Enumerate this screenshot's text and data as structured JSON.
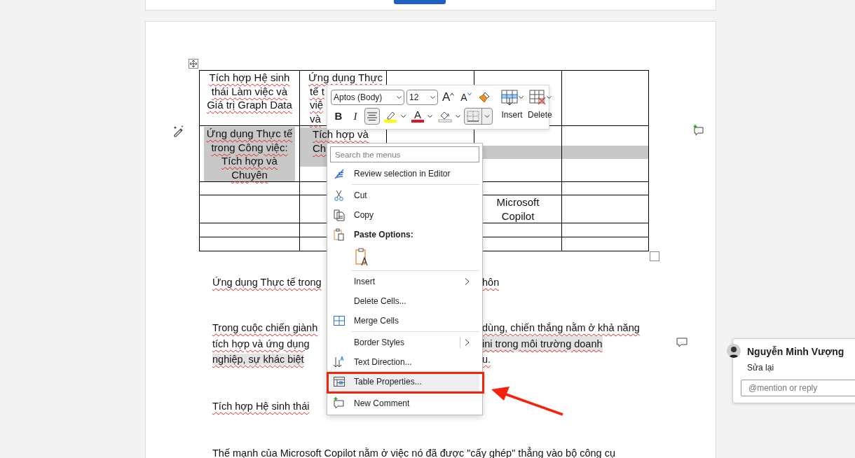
{
  "table": {
    "rows": [
      [
        {
          "lines": [
            "Tích hợp Hệ sinh",
            "thái Làm việc và",
            "Giá trị Graph Data"
          ]
        },
        {
          "lines": [
            "Ứng dụng Thực",
            "tế t",
            "việ",
            "và"
          ],
          "partial": true
        },
        {},
        {},
        {}
      ],
      [
        {
          "lines": [
            "Ứng dụng Thực tế",
            "trong Công việc:",
            "Tích hợp và",
            "Chuyên"
          ],
          "shaded": true
        },
        {
          "lines": [
            "Tích hợp và",
            "Ch"
          ],
          "shaded": true,
          "partial": true
        },
        {},
        {
          "shaded": true
        },
        {
          "shaded": true
        }
      ],
      [
        {},
        {},
        {},
        {},
        {}
      ],
      [
        {},
        {},
        {},
        {
          "lines": [
            "Microsoft",
            "Copilot"
          ]
        },
        {}
      ],
      [
        {},
        {},
        {},
        {},
        {}
      ],
      [
        {},
        {},
        {},
        {},
        {}
      ]
    ]
  },
  "paragraphs": [
    {
      "lines": [
        {
          "left": {
            "text": "Ứng dụng Thực tế trong"
          },
          "right": {
            "text": "hôn"
          }
        }
      ]
    },
    {
      "lines": [
        {
          "left": {
            "text": "Trong cuộc chiến giành"
          },
          "right": {
            "text": "dùng, chiến thắng nằm ở khả năng"
          }
        },
        {
          "left": {
            "text": "tích hợp và ứng dụng"
          },
          "right": {
            "text": "ini trong môi trường doanh",
            "highlighted": true
          }
        },
        {
          "left": {
            "text": "nghiệp, sự khác biệt",
            "highlighted": true
          },
          "right": {
            "text": "u."
          }
        }
      ]
    },
    {
      "lines": [
        {
          "left": {
            "text": "Tích hợp Hệ sinh thái"
          }
        }
      ]
    },
    {
      "lines": [
        {
          "left": {
            "text": "Thế mạnh của Microsoft Copilot nằm ở việc nó đã được \"cấy ghép\" thẳng vào bộ công cụ"
          }
        }
      ]
    }
  ],
  "mini_toolbar": {
    "font": "Aptos (Body)",
    "size": "12",
    "grow_glyph": "A",
    "shrink_glyph": "A",
    "format_buttons": [
      {
        "kind": "bold",
        "glyph": "B",
        "on": false
      },
      {
        "kind": "italic",
        "glyph": "I",
        "on": false
      },
      {
        "kind": "align",
        "on": true
      },
      {
        "kind": "highlight",
        "color": "#ffff00"
      },
      {
        "kind": "font-color",
        "glyph": "A",
        "color": "#e81123"
      },
      {
        "kind": "shading"
      },
      {
        "kind": "borders",
        "on": true
      }
    ],
    "table_buttons": [
      {
        "label": "Insert"
      },
      {
        "label": "Delete"
      }
    ]
  },
  "context_menu": {
    "search_placeholder": "Search the menus",
    "items": [
      {
        "kind": "item",
        "label": "Review selection in Editor",
        "highlighted": false
      },
      {
        "kind": "separator"
      },
      {
        "kind": "item",
        "label": "Cut",
        "highlighted": false
      },
      {
        "kind": "item",
        "label": "Copy",
        "highlighted": false
      },
      {
        "kind": "header",
        "label": "Paste Options:"
      },
      {
        "kind": "paste-options"
      },
      {
        "kind": "separator"
      },
      {
        "kind": "item",
        "label": "Insert",
        "submenu": true,
        "highlighted": false
      },
      {
        "kind": "item",
        "label": "Delete Cells...",
        "highlighted": false
      },
      {
        "kind": "item",
        "label": "Merge Cells",
        "highlighted": false
      },
      {
        "kind": "separator"
      },
      {
        "kind": "item",
        "label": "Border Styles",
        "submenu": true,
        "split": true,
        "highlighted": false
      },
      {
        "kind": "item",
        "label": "Text Direction...",
        "highlighted": false
      },
      {
        "kind": "item",
        "label": "Table Properties...",
        "highlighted": true
      },
      {
        "kind": "separator"
      },
      {
        "kind": "item",
        "label": "New Comment",
        "highlighted": false
      }
    ]
  },
  "comment": {
    "author": "Nguyễn Minh Vượng",
    "text": "Sửa lại",
    "reply_placeholder": "@mention or reply"
  }
}
